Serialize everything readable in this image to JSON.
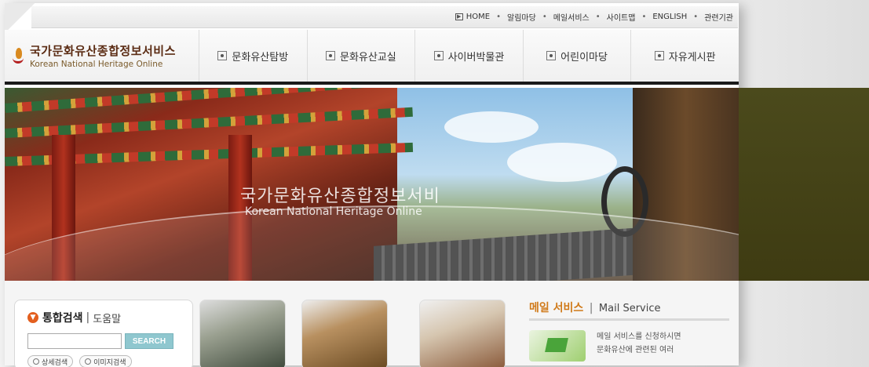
{
  "topbar": {
    "links": [
      "HOME",
      "알림마당",
      "메일서비스",
      "사이트맵",
      "ENGLISH",
      "관련기관"
    ]
  },
  "logo": {
    "name_ko": "국가문화유산종합정보서비스",
    "name_en": "Korean National Heritage Online"
  },
  "nav": {
    "items": [
      "문화유산탐방",
      "문화유산교실",
      "사이버박물관",
      "어린이마당",
      "자유게시판"
    ]
  },
  "hero": {
    "title": "국가문화유산종합정보서비",
    "subtitle": "Korean National Heritage Online"
  },
  "search": {
    "title": "통합검색",
    "help": "도움말",
    "input_value": "",
    "button": "SEARCH",
    "options": [
      "상세검색",
      "이미지검색"
    ]
  },
  "mail": {
    "title_ko": "메일 서비스",
    "title_en": "Mail Service",
    "text_line1": "메일 서비스를 신청하시면",
    "text_line2": "문화유산에 관련된 여러"
  }
}
